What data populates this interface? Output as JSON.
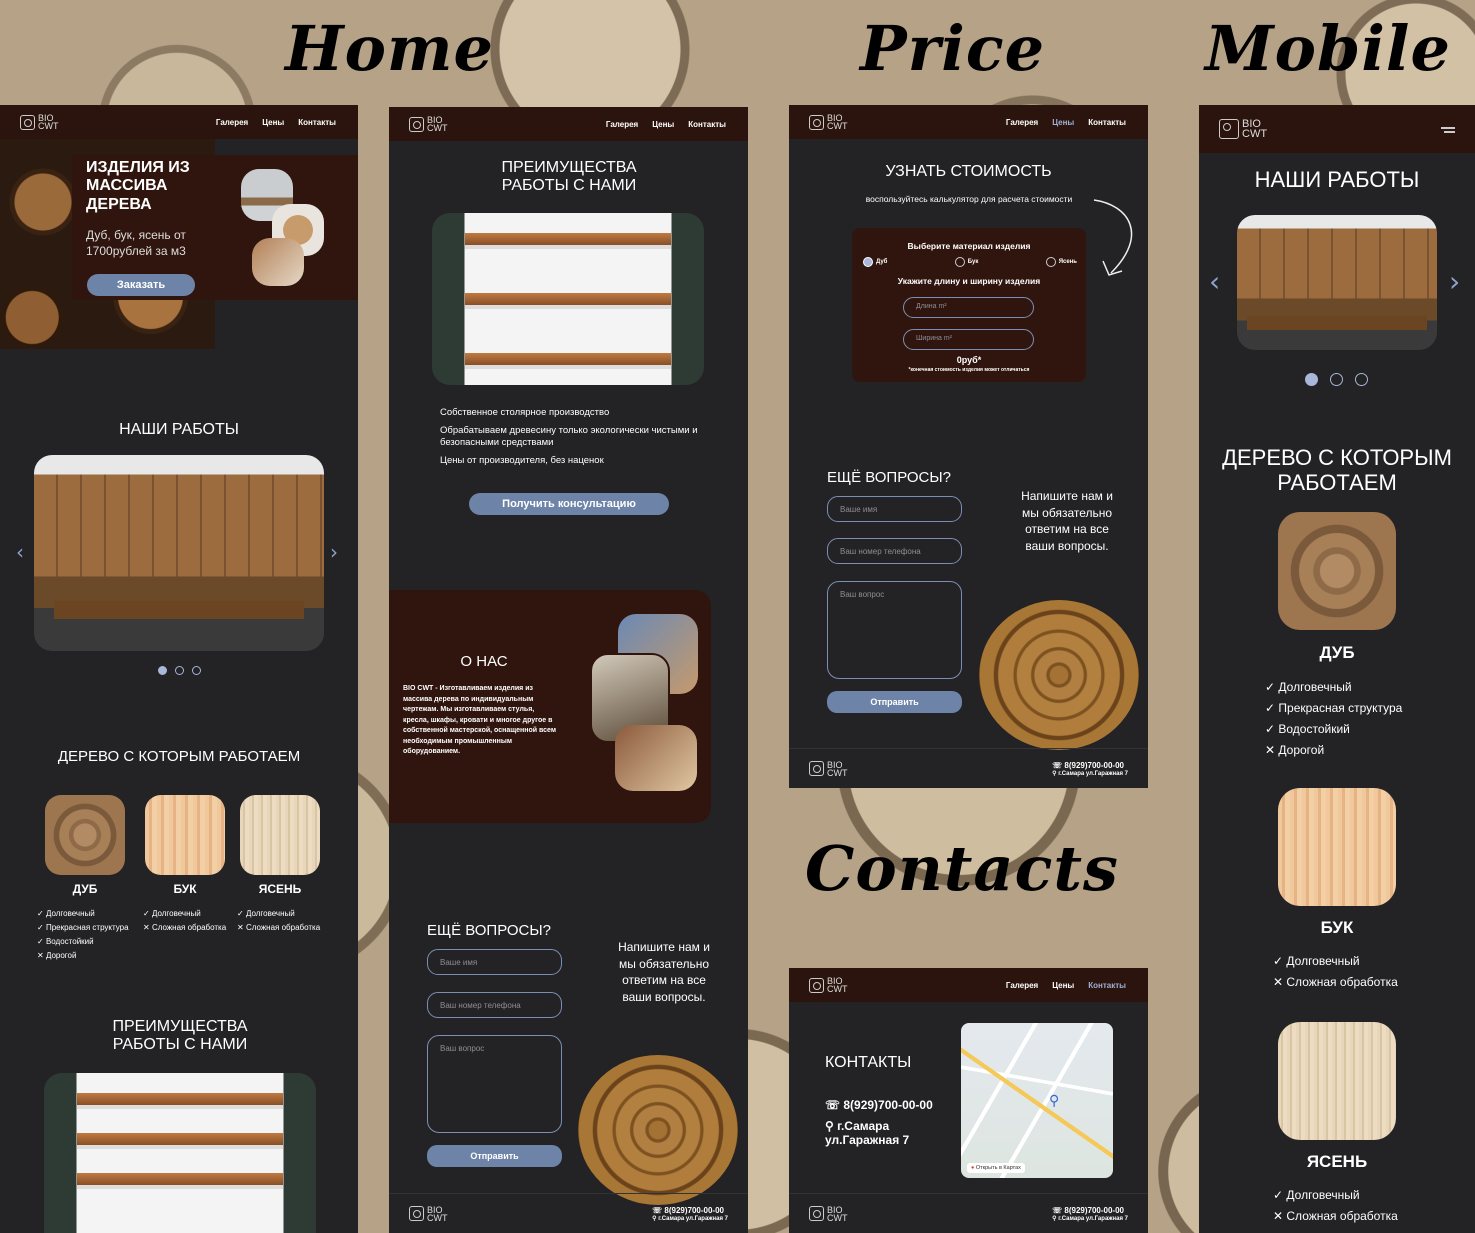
{
  "titles": {
    "home": "Home",
    "price": "Price",
    "mobile": "Mobile",
    "contacts": "Contacts"
  },
  "brand": {
    "logo_top": "BIO",
    "logo_bottom": "CWT"
  },
  "nav": {
    "gallery": "Галерея",
    "prices": "Цены",
    "contacts": "Контакты"
  },
  "home": {
    "hero_title": "ИЗДЕЛИЯ ИЗ МАССИВА ДЕРЕВА",
    "hero_subtitle": "Дуб, бук, ясень от 1700рублей за м3",
    "order_button": "Заказать",
    "works_title": "НАШИ РАБОТЫ",
    "wood_title": "ДЕРЕВО С КОТОРЫМ РАБОТАЕМ",
    "woods": [
      {
        "name": "ДУБ",
        "features": [
          "Долговечный",
          "Прекрасная структура",
          "Водостойкий",
          "Дорогой"
        ]
      },
      {
        "name": "БУК",
        "features": [
          "Долговечный",
          "Сложная обработка"
        ]
      },
      {
        "name": "ЯСЕНЬ",
        "features": [
          "Долговечный",
          "Сложная обработка"
        ]
      }
    ],
    "advantages_title": "ПРЕИМУЩЕСТВА РАБОТЫ С НАМИ"
  },
  "adv": {
    "title": "ПРЕИМУЩЕСТВА РАБОТЫ С НАМИ",
    "items": [
      "Собственное столярное производство",
      "Обрабатываем древесину только экологически чистыми и безопасными средствами",
      "Цены от производителя, без наценок"
    ],
    "consult_button": "Получить консультацию",
    "about_title": "О НАС",
    "about_text": "BIO CWT - Изготавливаем изделия из массива дерева по индивидуальным чертежам. Мы изготавливаем стулья, кресла, шкафы, кровати и многое другое в собственной мастерской, оснащенной всем необходимым промышленным оборудованием."
  },
  "questions": {
    "title": "ЕЩЁ ВОПРОСЫ?",
    "name_placeholder": "Ваше имя",
    "phone_placeholder": "Ваш номер телефона",
    "question_placeholder": "Ваш вопрос",
    "send_button": "Отправить",
    "side_text": "Напишите нам и мы обязательно ответим на все ваши вопросы."
  },
  "footer": {
    "phone": "8(929)700-00-00",
    "address": "г.Самара ул.Гаражная 7"
  },
  "price": {
    "title": "УЗНАТЬ СТОИМОСТЬ",
    "subtitle": "воспользуйтесь калькулятор для расчета стоимости",
    "material_label": "Выберите материал изделия",
    "options": [
      "Дуб",
      "Бук",
      "Ясень"
    ],
    "size_label": "Укажите длину и ширину изделия",
    "length_placeholder": "Длина m²",
    "width_placeholder": "Ширина m²",
    "result": "0руб*",
    "note": "*конечная стоимость изделия может отличаться"
  },
  "contacts": {
    "title": "КОНТАКТЫ",
    "phone": "8(929)700-00-00",
    "address": "г.Самара ул.Гаражная 7",
    "map_link": "Открыть в Картах"
  },
  "mobile": {
    "works_title": "НАШИ РАБОТЫ",
    "wood_title": "ДЕРЕВО С КОТОРЫМ РАБОТАЕМ",
    "woods": [
      {
        "name": "ДУБ",
        "features": [
          "Долговечный",
          "Прекрасная структура",
          "Водостойкий",
          "Дорогой"
        ]
      },
      {
        "name": "БУК",
        "features": [
          "Долговечный",
          "Сложная обработка"
        ]
      },
      {
        "name": "ЯСЕНЬ",
        "features": [
          "Долговечный",
          "Сложная обработка"
        ]
      }
    ]
  },
  "colors": {
    "accent": "#6d84a8",
    "header": "#2b140e",
    "panel": "#232224",
    "brown_card": "#2f150e"
  }
}
